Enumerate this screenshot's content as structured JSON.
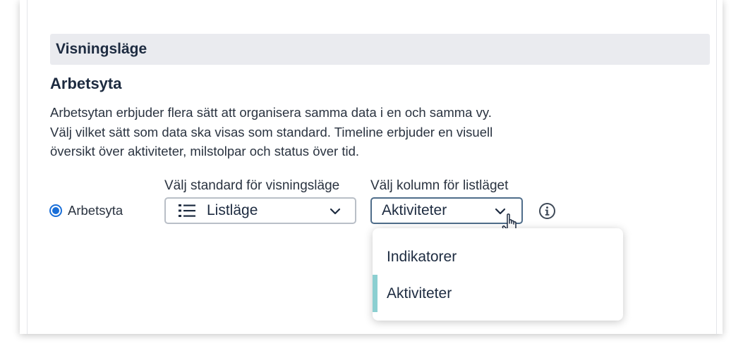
{
  "section": {
    "title": "Visningsläge"
  },
  "workspace": {
    "title": "Arbetsyta",
    "description": [
      "Arbetsytan erbjuder flera sätt att organisera samma data i en och samma vy.",
      "Välj vilket sätt som data ska visas som standard. Timeline erbjuder en visuell",
      "översikt över aktiviteter, milstolpar och status över tid."
    ]
  },
  "radio": {
    "label": "Arbetsyta",
    "checked": true
  },
  "view_select": {
    "label": "Välj standard för visningsläge",
    "value": "Listläge",
    "icon": "list-icon"
  },
  "column_select": {
    "label": "Välj kolumn för listläget",
    "value": "Aktiviteter",
    "expanded": true
  },
  "dropdown": {
    "options": [
      {
        "label": "Indikatorer",
        "selected": false
      },
      {
        "label": "Aktiviteter",
        "selected": true
      }
    ]
  },
  "colors": {
    "accent": "#1a6fd8",
    "selected_bar": "#8ccfd1",
    "header_bg": "#eaebef"
  }
}
